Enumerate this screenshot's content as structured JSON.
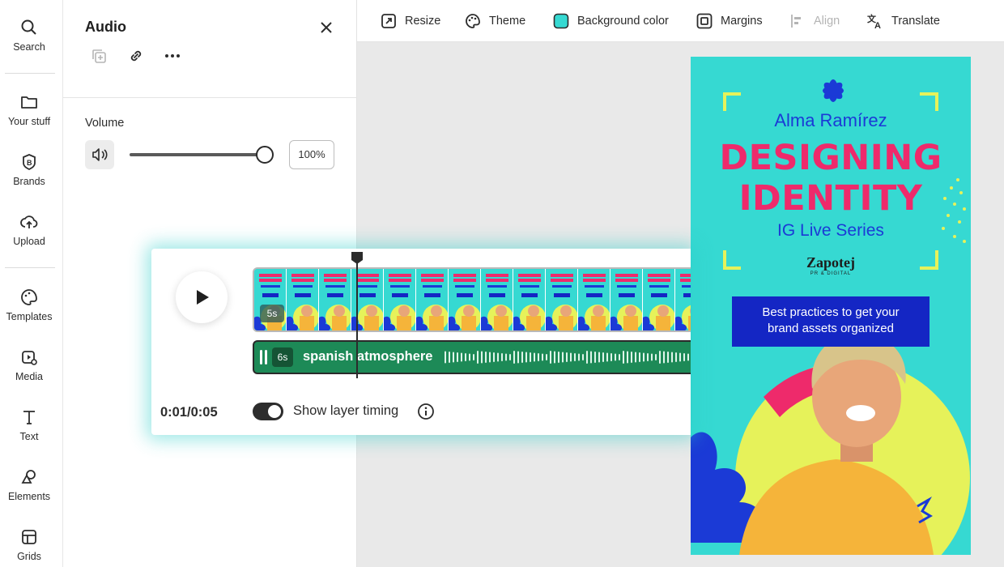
{
  "sidebar": {
    "items": [
      {
        "label": "Search",
        "icon": "search-icon"
      },
      {
        "label": "Your stuff",
        "icon": "folder-icon"
      },
      {
        "label": "Brands",
        "icon": "brand-icon"
      },
      {
        "label": "Upload",
        "icon": "cloud-upload-icon"
      },
      {
        "label": "Templates",
        "icon": "palette-icon"
      },
      {
        "label": "Media",
        "icon": "media-icon"
      },
      {
        "label": "Text",
        "icon": "text-icon"
      },
      {
        "label": "Elements",
        "icon": "shapes-icon"
      },
      {
        "label": "Grids",
        "icon": "grid-icon"
      }
    ]
  },
  "panel": {
    "title": "Audio",
    "volume_label": "Volume",
    "volume_value": "100%",
    "volume_level": 1.0
  },
  "toolbar": {
    "items": [
      {
        "label": "Resize",
        "icon": "resize-icon",
        "enabled": true
      },
      {
        "label": "Theme",
        "icon": "theme-palette-icon",
        "enabled": true
      },
      {
        "label": "Background color",
        "icon": "color-swatch-icon",
        "enabled": true,
        "swatch": "#36d9d2"
      },
      {
        "label": "Margins",
        "icon": "margins-icon",
        "enabled": true
      },
      {
        "label": "Align",
        "icon": "align-icon",
        "enabled": false
      },
      {
        "label": "Translate",
        "icon": "translate-icon",
        "enabled": true
      }
    ]
  },
  "design": {
    "name": "Alma Ramírez",
    "headline_line1": "DESIGNING",
    "headline_line2": "IDENTITY",
    "subtitle": "IG Live Series",
    "brand": "Zapotej",
    "brand_tagline": "PR & DIGITAL",
    "box_text_line1": "Best practices to get your",
    "box_text_line2": "brand assets organized",
    "colors": {
      "background": "#36d9d2",
      "headline": "#ee2a6b",
      "accent_blue": "#1b3ad6",
      "bracket": "#e6f25a",
      "box": "#1426c4"
    }
  },
  "timeline": {
    "video_duration": "5s",
    "audio_duration": "6s",
    "audio_name": "spanish atmosphere",
    "time_readout": "0:01/0:05",
    "show_layer_timing_label": "Show layer timing",
    "show_layer_timing_on": true
  }
}
